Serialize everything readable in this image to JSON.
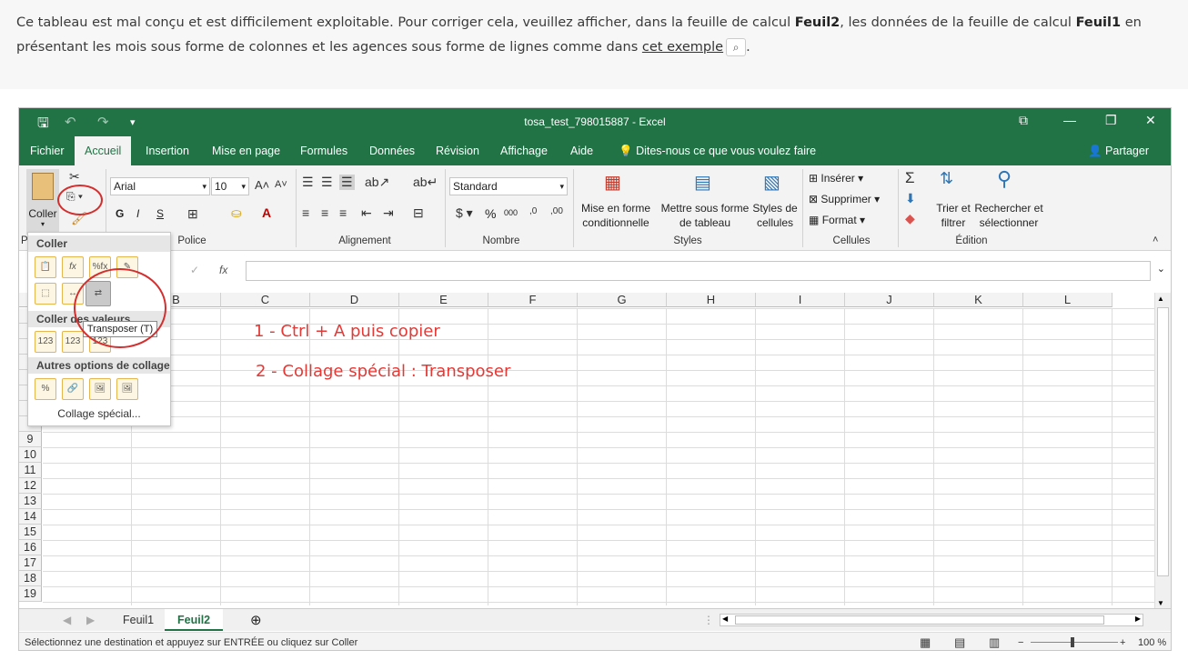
{
  "instruction": {
    "part1": "Ce tableau est mal conçu et est difficilement exploitable. Pour corriger cela, veuillez afficher, dans la feuille de calcul ",
    "feuil2": "Feuil2",
    "part2": ", les données de la feuille de calcul ",
    "feuil1": "Feuil1",
    "part3": " en présentant les mois sous forme de colonnes et les agences sous forme de lignes comme dans ",
    "link": "cet exemple",
    "end": "."
  },
  "window": {
    "title": "tosa_test_798015887  -  Excel"
  },
  "menu": {
    "tabs": [
      "Fichier",
      "Accueil",
      "Insertion",
      "Mise en page",
      "Formules",
      "Données",
      "Révision",
      "Affichage",
      "Aide"
    ],
    "tell_me": "Dites-nous ce que vous voulez faire",
    "share": "Partager"
  },
  "ribbon": {
    "paste_label": "Coller",
    "font_name": "Arial",
    "font_size": "10",
    "bold": "G",
    "italic": "I",
    "underline": "S",
    "number_format": "Standard",
    "percent": "%",
    "thousands": "000",
    "cond_format_1": "Mise en forme",
    "cond_format_2": "conditionnelle",
    "table_format_1": "Mettre sous forme",
    "table_format_2": "de tableau",
    "cell_styles_1": "Styles de",
    "cell_styles_2": "cellules",
    "insert": "Insérer",
    "delete": "Supprimer",
    "format": "Format",
    "sort_1": "Trier et",
    "sort_2": "filtrer",
    "find_1": "Rechercher et",
    "find_2": "sélectionner",
    "groups": {
      "clipboard_initial": "P",
      "police": "Police",
      "alignement": "Alignement",
      "nombre": "Nombre",
      "styles": "Styles",
      "cellules": "Cellules",
      "edition": "Édition"
    }
  },
  "formula_bar": {
    "fx": "fx",
    "check": "✓"
  },
  "columns": [
    "B",
    "C",
    "D",
    "E",
    "F",
    "G",
    "H",
    "I",
    "J",
    "K",
    "L"
  ],
  "rows": [
    "9",
    "10",
    "11",
    "12",
    "13",
    "14",
    "15",
    "16",
    "17",
    "18",
    "19"
  ],
  "annotations": {
    "step1": "1 - Ctrl + A puis copier",
    "step2": "2 - Collage spécial : Transposer"
  },
  "paste_menu": {
    "section_paste": "Coller",
    "section_values": "Coller des valeurs",
    "section_other": "Autres options de collage",
    "special": "Collage spécial...",
    "tooltip": "Transposer (T)",
    "values_icon_text": "123"
  },
  "sheets": {
    "tab1": "Feuil1",
    "tab2": "Feuil2"
  },
  "status": {
    "message": "Sélectionnez une destination et appuyez sur ENTRÉE ou cliquez sur Coller",
    "zoom": "100 %"
  }
}
